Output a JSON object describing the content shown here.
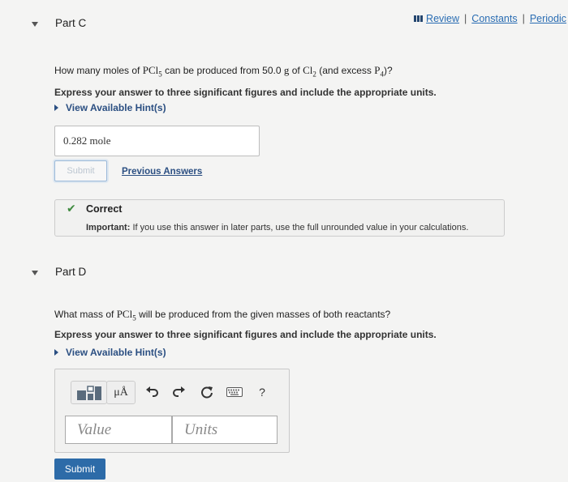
{
  "links": {
    "review": "Review",
    "constants": "Constants",
    "periodic": "Periodic",
    "sep": "|"
  },
  "partC": {
    "title": "Part C",
    "q": {
      "pre": "How many moles of",
      "pcl5_main": "PCl",
      "pcl5_sub": "5",
      "mid": "can be produced from",
      "amount_val": "50.0",
      "amount_unit": "g",
      "of": "of",
      "cl2_main": "Cl",
      "cl2_sub": "2",
      "excess_pre": "(and excess",
      "p4_main": "P",
      "p4_sub": "4",
      "excess_post": ")?"
    },
    "instruction": "Express your answer to three significant figures and include the appropriate units.",
    "hint": "View Available Hint(s)",
    "answer": "0.282 mole",
    "submit": "Submit",
    "previous": "Previous Answers",
    "feedback": {
      "title": "Correct",
      "important_label": "Important:",
      "important_text": " If you use this answer in later parts, use the full unrounded value in your calculations."
    }
  },
  "partD": {
    "title": "Part D",
    "q": {
      "pre": "What mass of",
      "pcl5_main": "PCl",
      "pcl5_sub": "5",
      "post": "will be produced from the given masses of both reactants?"
    },
    "instruction": "Express your answer to three significant figures and include the appropriate units.",
    "hint": "View Available Hint(s)",
    "toolbar": {
      "mu": "μÅ",
      "help": "?"
    },
    "value_placeholder": "Value",
    "units_placeholder": "Units",
    "submit": "Submit"
  }
}
